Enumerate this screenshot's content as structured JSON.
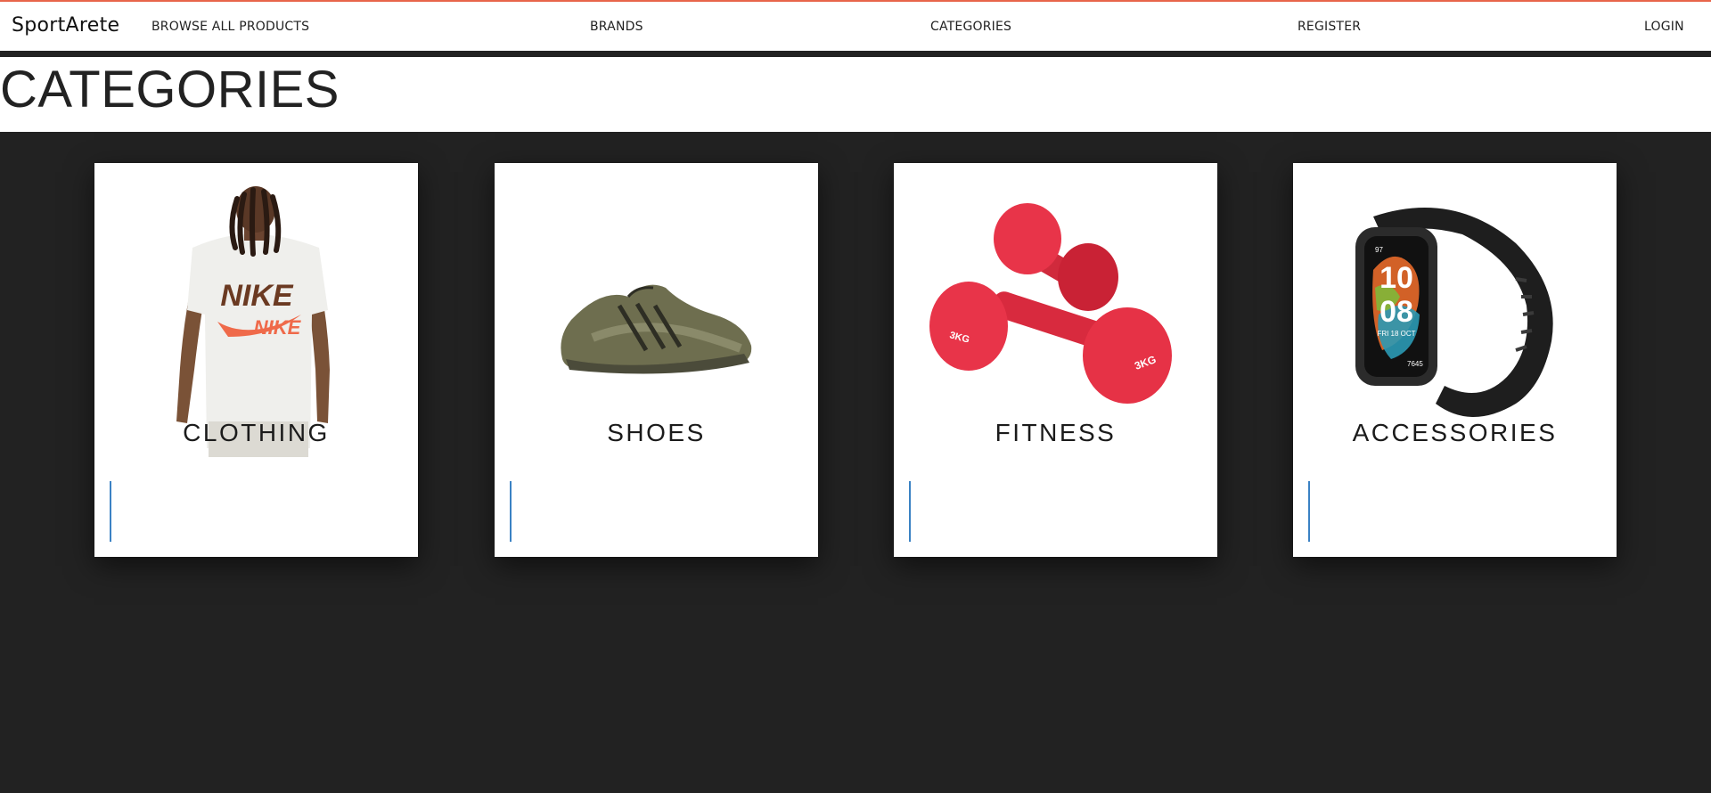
{
  "nav": {
    "brand": "SportArete",
    "links": [
      "BROWSE ALL PRODUCTS",
      "BRANDS",
      "CATEGORIES",
      "REGISTER",
      "LOGIN"
    ]
  },
  "page": {
    "title": "CATEGORIES"
  },
  "categories": [
    {
      "label": "CLOTHING",
      "icon": "tshirt-model-image"
    },
    {
      "label": "SHOES",
      "icon": "sneaker-image"
    },
    {
      "label": "FITNESS",
      "icon": "dumbbells-image"
    },
    {
      "label": "ACCESSORIES",
      "icon": "smartwatch-image"
    }
  ],
  "colors": {
    "accent_top_border": "#e8654a",
    "page_background": "#222222",
    "card_background": "#ffffff",
    "focus_line": "#3b82c4"
  }
}
